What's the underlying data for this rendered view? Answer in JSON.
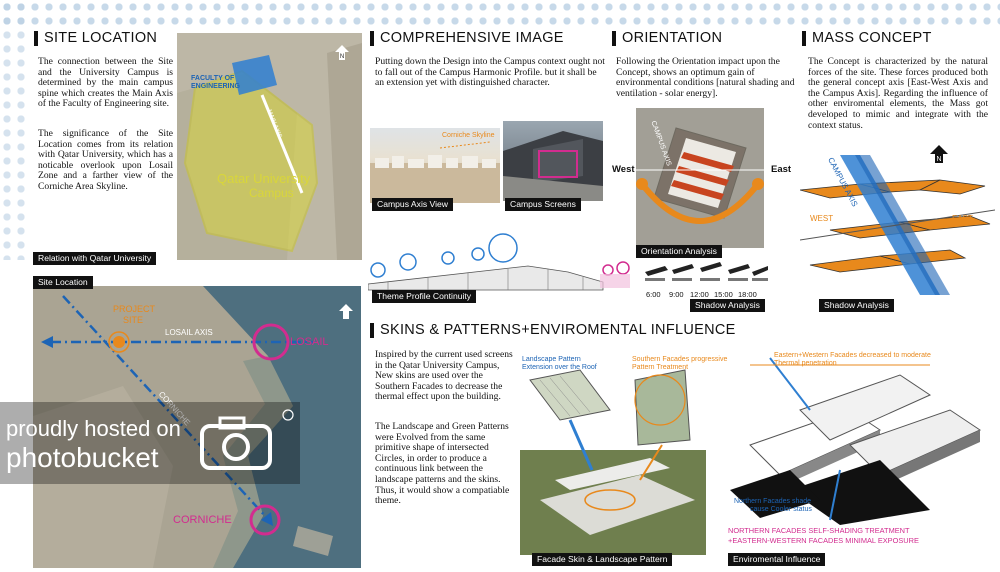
{
  "site_location": {
    "title": "SITE LOCATION",
    "paragraph1": "The connection between the Site and the University Campus is determined by the main campus spine which creates the Main Axis of the Faculty of Engineering site.",
    "paragraph2": "The significance of the Site Location comes from its relation with Qatar University, which has a noticable overlook upon Losail Zone and a farther view of the Corniche Area Skyline.",
    "caption_relation": "Relation with Qatar University",
    "caption_site": "Site Location",
    "map1_labels": {
      "faculty": "FACULTY OF ENGINEERING",
      "axis": "MAIN AXIS",
      "campus_line1": "Qatar University",
      "campus_line2": "Campus"
    },
    "map2_labels": {
      "project_line1": "PROJECT",
      "project_line2": "SITE",
      "losail_axis": "LOSAIL AXIS",
      "losail": "LOSAIL",
      "corniche_axis": "CORNICHE",
      "corniche": "CORNICHE"
    }
  },
  "comprehensive_image": {
    "title": "COMPREHENSIVE IMAGE",
    "paragraph": "Putting down the Design into the Campus context ought not to fall out of the Campus Harmonic Profile. but it shall be an extension yet with distinguished character.",
    "skyline_label": "Corniche Skyline",
    "caption_axis": "Campus Axis View",
    "caption_screens": "Campus Screens",
    "caption_profile": "Theme Profile Continuity"
  },
  "orientation": {
    "title": "ORIENTATION",
    "paragraph": "Following the Orientation impact upon the Concept, shows an optimum gain of environmental conditions [natural shading and ventilation - solar energy].",
    "west": "West",
    "east": "East",
    "campus_axis": "CAMPUS AXIS",
    "caption_orientation": "Orientation Analysis",
    "shadow_times": [
      "6:00",
      "9:00",
      "12:00",
      "15:00",
      "18:00"
    ],
    "caption_shadow": "Shadow Analysis"
  },
  "mass_concept": {
    "title": "MASS CONCEPT",
    "paragraph": "The Concept is characterized by the natural forces of the site. These forces produced both the general concept axis [East-West Axis and the Campus Axis]. Regarding the influence of other enviromental elements, the Mass got developed to mimic and integrate with the context status.",
    "campus_axis": "CAMPUS AXIS",
    "west": "WEST",
    "east": "EAST",
    "caption_shadow": "Shadow Analysis"
  },
  "skins": {
    "title": "SKINS & PATTERNS+ENVIROMENTAL INFLUENCE",
    "paragraph1": "Inspired by the current used screens in the Qatar University Campus, New skins are used over the Southern Facades to decrease the thermal effect upon the building.",
    "paragraph2": "The Landscape and Green Patterns were Evolved from the same primitive shape of intersected Circles, in order to produce a continuous link between the landscape patterns and the skins. Thus, it would show a compatiable theme.",
    "landscape_note_line1": "Landscape Pattern",
    "landscape_note_line2": "Extension over the Roof",
    "southern_note_line1": "Southern Facades progressive",
    "southern_note_line2": "Pattern Treatment",
    "ew_note_line1": "Eastern+Western Facades decreased to moderate",
    "ew_note_line2": "Thermal penetration",
    "north_note_line1": "Northern Facades shade",
    "north_note_line2": "cause Cooler status",
    "caption_facade": "Facade Skin & Landscape Pattern",
    "caption_env": "Enviromental Influence",
    "bottom_note_line1": "NORTHERN FACADES SELF-SHADING TREATMENT",
    "bottom_note_line2": "+EASTERN-WESTERN FACADES MINIMAL EXPOSURE"
  },
  "watermark": {
    "line1": "proudly hosted on",
    "line2": "photobucket"
  },
  "colors": {
    "gold": "#e8891c",
    "pink": "#d22c8f",
    "blue": "#1d64b5",
    "yellow_overlay": "#d9d63a"
  }
}
